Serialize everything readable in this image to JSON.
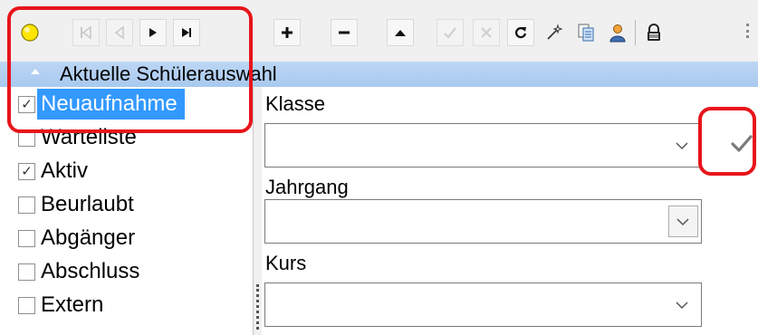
{
  "toolbar": {
    "buttons": [
      {
        "name": "status-indicator-icon"
      },
      {
        "name": "first-record-icon",
        "enabled": false
      },
      {
        "name": "previous-record-icon",
        "enabled": false
      },
      {
        "name": "next-record-icon",
        "enabled": true
      },
      {
        "name": "last-record-icon",
        "enabled": true
      },
      {
        "name": "add-record-icon",
        "enabled": true
      },
      {
        "name": "delete-record-icon",
        "enabled": true
      },
      {
        "name": "edit-record-icon",
        "enabled": true
      },
      {
        "name": "post-edit-icon",
        "enabled": false
      },
      {
        "name": "cancel-edit-icon",
        "enabled": false
      },
      {
        "name": "refresh-icon",
        "enabled": true
      },
      {
        "name": "magic-wand-icon",
        "enabled": true
      },
      {
        "name": "copy-icon",
        "enabled": true
      },
      {
        "name": "user-icon",
        "enabled": true
      },
      {
        "name": "lock-icon",
        "enabled": true
      }
    ]
  },
  "panel": {
    "title": "Aktuelle Schülerauswahl"
  },
  "statusList": [
    {
      "label": "Neuaufnahme",
      "checked": true,
      "selected": true
    },
    {
      "label": "Warteliste",
      "checked": false,
      "selected": false
    },
    {
      "label": "Aktiv",
      "checked": true,
      "selected": false
    },
    {
      "label": "Beurlaubt",
      "checked": false,
      "selected": false
    },
    {
      "label": "Abgänger",
      "checked": false,
      "selected": false
    },
    {
      "label": "Abschluss",
      "checked": false,
      "selected": false
    },
    {
      "label": "Extern",
      "checked": false,
      "selected": false
    }
  ],
  "filters": {
    "klasse": {
      "label": "Klasse",
      "value": ""
    },
    "jahrgang": {
      "label": "Jahrgang",
      "value": ""
    },
    "kurs": {
      "label": "Kurs",
      "value": ""
    }
  },
  "colors": {
    "accent": "#3399ff",
    "header": "#b3d0f2",
    "annotation": "#e8141b"
  }
}
